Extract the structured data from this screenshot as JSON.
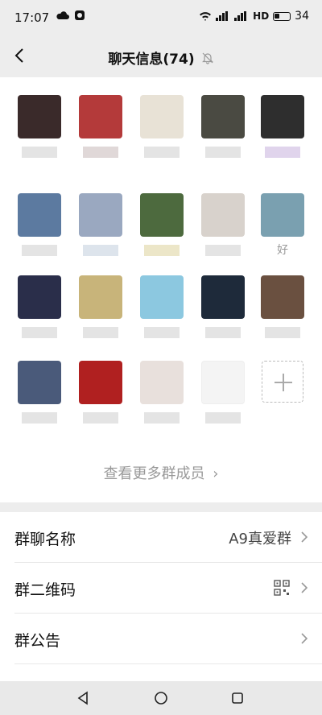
{
  "status": {
    "time": "17:07",
    "network": "HD",
    "battery": "34"
  },
  "nav": {
    "title": "聊天信息(74)"
  },
  "members": [
    {
      "color": "#3a2a2a"
    },
    {
      "color": "#b43a3a"
    },
    {
      "color": "#e8e2d6"
    },
    {
      "color": "#4a4a42"
    },
    {
      "color": "#2e2e2e"
    },
    {
      "color": "#5c7aa0"
    },
    {
      "color": "#9aa8c0"
    },
    {
      "color": "#4d6a3e"
    },
    {
      "color": "#d8d2cc"
    },
    {
      "color": "#7aa0b0"
    },
    {
      "color": "#2a2e4a"
    },
    {
      "color": "#c8b47a"
    },
    {
      "color": "#8cc8e0"
    },
    {
      "color": "#1e2a3a"
    },
    {
      "color": "#6a5040"
    },
    {
      "color": "#4a5a7a"
    },
    {
      "color": "#b02020"
    },
    {
      "color": "#e8e0dc"
    },
    {
      "color": "#f4f4f4"
    }
  ],
  "member_labels": {
    "m10": "好"
  },
  "add_member": {
    "icon": "plus-icon"
  },
  "more_members": {
    "label": "查看更多群成员"
  },
  "settings": {
    "group_name": {
      "label": "群聊名称",
      "value": "A9真爱群"
    },
    "qr": {
      "label": "群二维码"
    },
    "notice": {
      "label": "群公告"
    }
  }
}
